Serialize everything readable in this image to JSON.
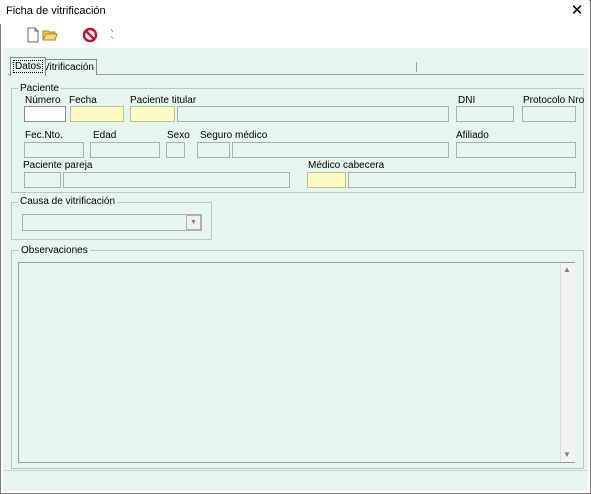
{
  "window": {
    "title": "Ficha de vitrificación"
  },
  "toolbar": {
    "icons": [
      "new-document-icon",
      "open-folder-icon",
      "cancel-icon",
      "separator-icon"
    ]
  },
  "tabs": [
    {
      "label": "Datos",
      "active": true
    },
    {
      "label": "Vitrificación",
      "active": false
    }
  ],
  "paciente": {
    "group_label": "Paciente",
    "numero_label": "Número",
    "fecha_label": "Fecha",
    "paciente_titular_label": "Paciente titular",
    "dni_label": "DNI",
    "protocolo_label": "Protocolo Nro",
    "fec_nto_label": "Fec.Nto.",
    "edad_label": "Edad",
    "sexo_label": "Sexo",
    "seguro_label": "Seguro médico",
    "afiliado_label": "Afiliado",
    "pareja_label": "Paciente pareja",
    "medico_label": "Médico cabecera",
    "fields": {
      "numero": "",
      "fecha": "",
      "titular_code": "",
      "titular_name": "",
      "dni": "",
      "protocolo": "",
      "fec_nto": "",
      "edad": "",
      "sexo": "",
      "seguro_code": "",
      "seguro_name": "",
      "afiliado": "",
      "pareja_code": "",
      "pareja_name": "",
      "medico_code": "",
      "medico_name": ""
    }
  },
  "causa": {
    "group_label": "Causa de vitrificación",
    "selected": ""
  },
  "observaciones": {
    "group_label": "Observaciones",
    "text": ""
  },
  "colors": {
    "client_bg": "#e6f5ee",
    "required_bg": "#fdfbc4",
    "editable_bg": "#ffffff"
  }
}
